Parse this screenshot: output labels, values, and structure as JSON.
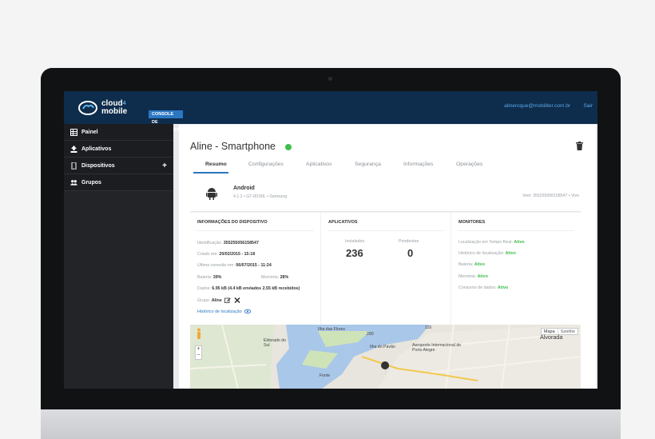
{
  "header": {
    "logo_line1": "cloud",
    "logo_sup": "4",
    "logo_line2": "mobile",
    "badge": "CONSOLE DE OPERAÇÕES",
    "user_email": "alineroque@mobiliter.com.br",
    "logout": "Sair"
  },
  "sidebar": {
    "items": [
      {
        "label": "Painel",
        "icon": "table-icon"
      },
      {
        "label": "Aplicativos",
        "icon": "upload-icon"
      },
      {
        "label": "Dispositivos",
        "icon": "phone-icon"
      },
      {
        "label": "Grupos",
        "icon": "users-icon"
      }
    ],
    "add_symbol": "+"
  },
  "device": {
    "title": "Aline - Smartphone",
    "status_color": "#3fbf4c",
    "tabs": [
      "Resumo",
      "Configurações",
      "Aplicativos",
      "Segurança",
      "Informações",
      "Operações"
    ],
    "active_tab": "Resumo",
    "os": "Android",
    "os_details": "4.1.2  •  GT-I8190L  •  Samsung",
    "imei": "Imei: 355255056158547  •  Vivo"
  },
  "info_card": {
    "heading": "INFORMAÇÕES DO DISPOSITIVO",
    "identificacao_label": "Identificação:",
    "identificacao_value": "355255056158547",
    "criado_label": "Criado em:",
    "criado_value": "20/02/2015 - 15:18",
    "conexao_label": "Última conexão em:",
    "conexao_value": "06/07/2015 - 11:24",
    "bateria_label": "Bateria:",
    "bateria_value": "39%",
    "memoria_label": "Memória:",
    "memoria_value": "28%",
    "dados_label": "Dados:",
    "dados_value": "6.95 kB (4.4 kB enviados 2.55 kB recebidos)",
    "grupo_label": "Grupo:",
    "grupo_value": "Aline",
    "historico_link": "Histórico de localização"
  },
  "apps_card": {
    "heading": "APLICATIVOS",
    "installed_label": "Instalados",
    "installed_value": "236",
    "pending_label": "Pendentes",
    "pending_value": "0"
  },
  "monitors_card": {
    "heading": "MONITORES",
    "items": [
      {
        "label": "Localização em Tempo Real:",
        "value": "Ativo"
      },
      {
        "label": "Histórico de localização:",
        "value": "Ativo"
      },
      {
        "label": "Bateria:",
        "value": "Ativo"
      },
      {
        "label": "Memória:",
        "value": "Ativo"
      },
      {
        "label": "Consumo de dados:",
        "value": "Ativo"
      }
    ],
    "active_color": "#3fbf4c"
  },
  "map": {
    "btn_map": "Mapa",
    "btn_satellite": "Satélite",
    "zoom_in": "+",
    "zoom_out": "−",
    "labels": [
      "Ilha das Flores",
      "Eldorado do Sul",
      "Ilha do Pavão",
      "Aeroporto Internacional de Porto Alegre",
      "Alvorada",
      "Fonte",
      "116",
      "290"
    ]
  }
}
